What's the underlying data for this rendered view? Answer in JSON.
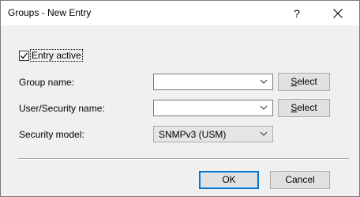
{
  "window": {
    "title": "Groups - New Entry",
    "help_label": "?"
  },
  "form": {
    "entry_active": {
      "label": "Entry active",
      "checked": true
    },
    "group_name": {
      "label": "Group name:",
      "value": "",
      "select_label": "Select"
    },
    "user_security_name": {
      "label": "User/Security name:",
      "value": "",
      "select_label": "Select"
    },
    "security_model": {
      "label": "Security model:",
      "value": "SNMPv3 (USM)"
    }
  },
  "buttons": {
    "ok_label": "OK",
    "cancel_label": "Cancel"
  },
  "icons": {
    "close": "close-icon",
    "check": "checkmark-icon",
    "dropdown": "chevron-down-icon"
  },
  "colors": {
    "default_button_border": "#0078d7",
    "dialog_background": "#f0f0f0",
    "titlebar_background": "#ffffff"
  }
}
